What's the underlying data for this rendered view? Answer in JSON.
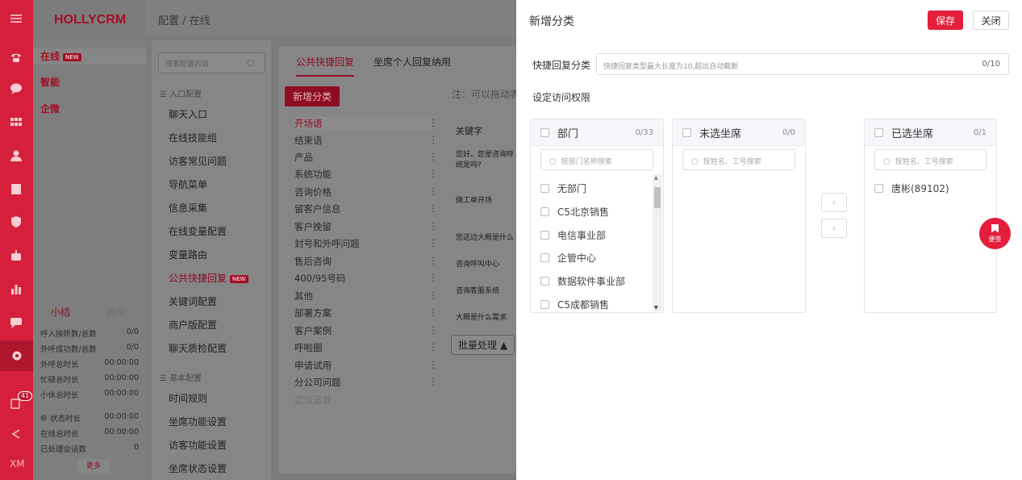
{
  "app": {
    "brand": "HOLLYCRM",
    "breadcrumb": "配置 / 在线"
  },
  "rail": {
    "badge_count": "41",
    "user_initials": "XM"
  },
  "channels": [
    {
      "label": "在线",
      "tag": "NEW"
    },
    {
      "label": "智能"
    },
    {
      "label": "企微"
    }
  ],
  "stats": {
    "tab_summary": "小结",
    "tab_queue": "排队",
    "rows": [
      {
        "label": "呼入接听数/总数",
        "value": "0/0"
      },
      {
        "label": "外呼成功数/总数",
        "value": "0/0"
      },
      {
        "label": "外呼总时长",
        "value": "00:00:00"
      },
      {
        "label": "忙碌总时长",
        "value": "00:00:00"
      },
      {
        "label": "小休总时长",
        "value": "00:00:00"
      },
      {
        "label": "状态时长",
        "value": "00:00:00"
      },
      {
        "label": "在线总时长",
        "value": "00:00:00"
      },
      {
        "label": "已处理会话数",
        "value": "0"
      }
    ],
    "more": "更多"
  },
  "menu": {
    "search_placeholder": "搜索配置内容",
    "section1": "入口配置",
    "items1": [
      "聊天入口",
      "在线技能组",
      "访客常见问题",
      "导航菜单",
      "信息采集",
      "在线变量配置",
      "变量路由",
      "公共快捷回复",
      "关键词配置",
      "商户版配置",
      "聊天质检配置"
    ],
    "active_tag": "NEW",
    "section2": "基本配置",
    "items2": [
      "时间规则",
      "坐席功能设置",
      "访客功能设置",
      "坐席状态设置"
    ]
  },
  "content": {
    "tabs": [
      "公共快捷回复",
      "坐席个人回复纳用"
    ],
    "add_button": "新增分类",
    "note": "注：可以拖动表",
    "categories": [
      "开场语",
      "结束语",
      "产品",
      "系统功能",
      "咨询价格",
      "留客户信息",
      "客户挽留",
      "封号和外呼问题",
      "售后咨询",
      "400/95号码",
      "其他",
      "部署方案",
      "客户案例",
      "呼啦圈",
      "申请试用",
      "分公司问题",
      "武汉运营"
    ],
    "kw_header": "关键字",
    "keywords": [
      "您好。您是咨询呼统是吗?",
      "微工单开场",
      "您这边大概是什么",
      "咨询呼叫中心",
      "咨询客服系统",
      "大概是什么需求"
    ],
    "batch": "批量处理"
  },
  "drawer": {
    "title": "新增分类",
    "save": "保存",
    "close": "关闭",
    "name_label": "快捷回复分类",
    "name_placeholder": "快捷回复类型最大长度为10,超出自动截断",
    "name_count": "0/10",
    "perm_label": "设定访问权限",
    "dept_panel": {
      "title": "部门",
      "count": "0/33",
      "search_placeholder": "按部门名称搜索",
      "items": [
        "无部门",
        "C5北京销售",
        "电信事业部",
        "企管中心",
        "数据软件事业部",
        "C5成都销售"
      ]
    },
    "unselected_panel": {
      "title": "未选坐席",
      "count": "0/0",
      "search_placeholder": "按姓名、工号搜索"
    },
    "selected_panel": {
      "title": "已选坐席",
      "count": "0/1",
      "search_placeholder": "按姓名、工号搜索",
      "items": [
        "唐彬(89102)"
      ]
    },
    "bookmark_label": "便签"
  }
}
